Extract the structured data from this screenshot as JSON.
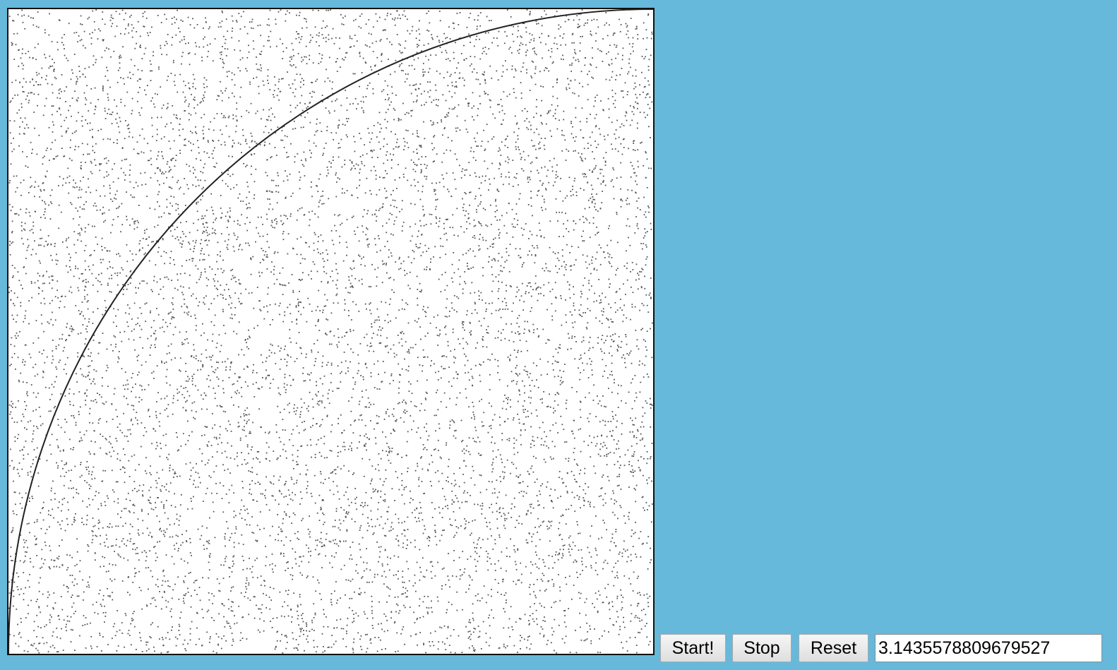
{
  "controls": {
    "start_label": "Start!",
    "stop_label": "Stop",
    "reset_label": "Reset"
  },
  "output": {
    "value": "3.1435578809679527"
  },
  "colors": {
    "background": "#66b9da",
    "canvas_background": "#ffffff",
    "point_color": "#555555",
    "arc_color": "#222222"
  }
}
